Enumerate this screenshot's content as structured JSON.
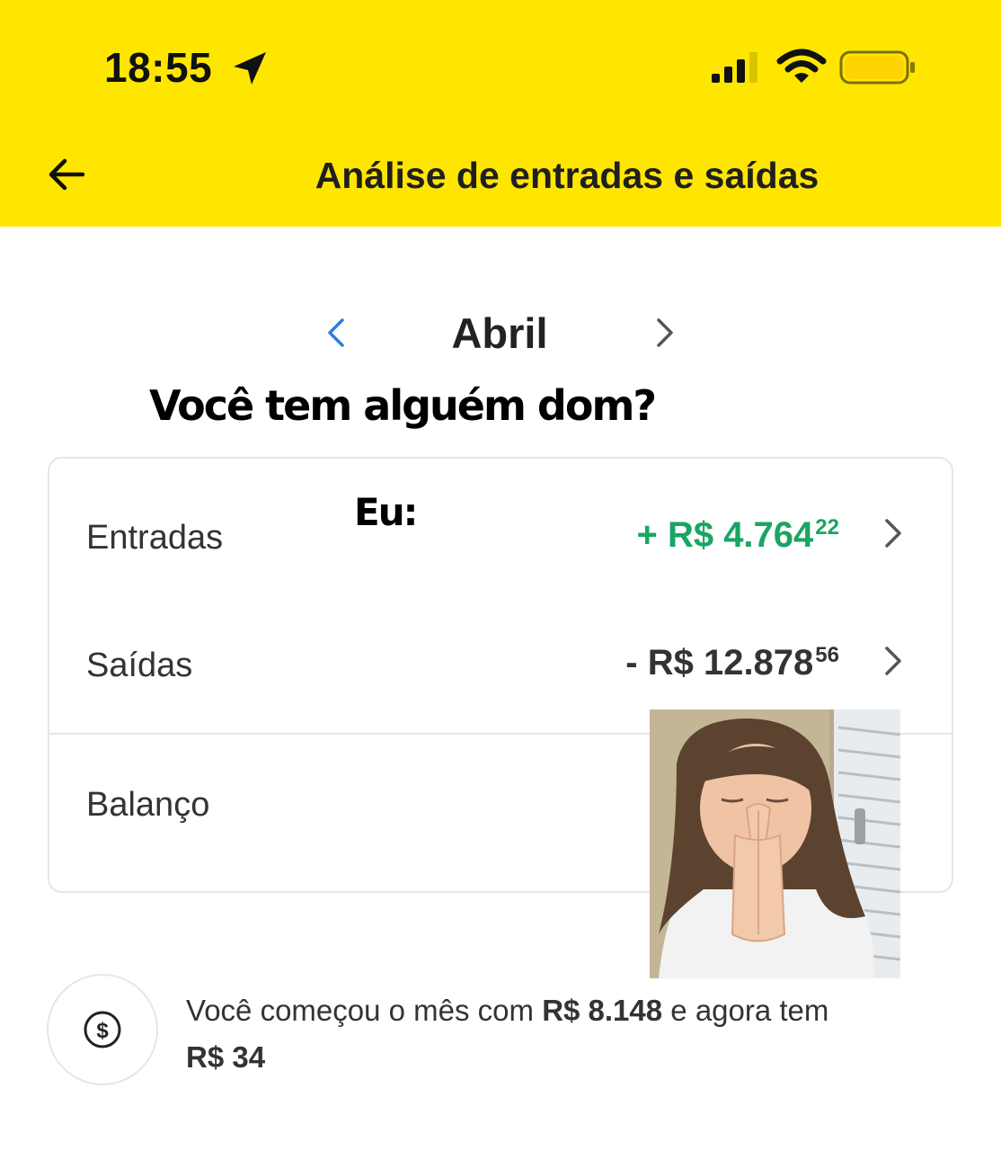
{
  "status_bar": {
    "time": "18:55",
    "icons": [
      "location-arrow-icon",
      "signal-icon",
      "wifi-icon",
      "battery-icon"
    ],
    "battery_color": "#FFE600"
  },
  "header": {
    "title": "Análise de entradas e saídas",
    "background_color": "#FFE600"
  },
  "month_selector": {
    "label": "Abril"
  },
  "overlay": {
    "caption_top": "Você tem alguém dom?",
    "caption_eu": "Eu:",
    "photo": "girl-praying-meme"
  },
  "summary_card": {
    "rows": [
      {
        "label": "Entradas",
        "prefix": "+ R$ 4.764",
        "cents": "22",
        "color": "#1aa563"
      },
      {
        "label": "Saídas",
        "prefix": "- R$ 12.878",
        "cents": "56",
        "color": "#333333"
      },
      {
        "label": "Balanço"
      }
    ]
  },
  "footer_note": {
    "text_1": "Você começou o mês com ",
    "start_amount": "R$ 8.148",
    "text_2": " e agora tem ",
    "current_amount": "R$ 34"
  }
}
